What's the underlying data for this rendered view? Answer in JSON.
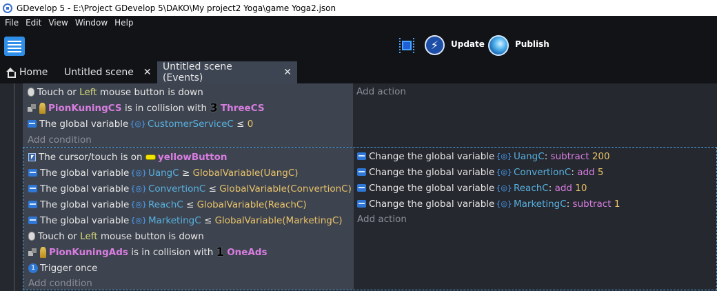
{
  "window": {
    "title": "GDevelop 5 - E:\\Project GDevelop 5\\DAKO\\My project2 Yoga\\game Yoga2.json"
  },
  "menu": [
    "File",
    "Edit",
    "View",
    "Window",
    "Help"
  ],
  "toolbar": {
    "update_label": "Update",
    "publish_label": "Publish"
  },
  "tabs": [
    {
      "label": "Home"
    },
    {
      "label": "Untitled scene"
    },
    {
      "label": "Untitled scene (Events)"
    }
  ],
  "tab_close": "✕",
  "events": [
    {
      "conditions": {
        "touch": {
          "pre": "Touch or",
          "button": "Left",
          "post": "mouse button is down"
        },
        "collision": {
          "object": "PionKuningCS",
          "text": "is in collision with",
          "number": "3",
          "target": "ThreeCS"
        },
        "variable": {
          "text": "The global variable",
          "name": "CustomerServiceC",
          "op": "≤",
          "value": "0"
        },
        "add": "Add condition"
      },
      "actions": {
        "add": "Add action"
      }
    },
    {
      "conditions": {
        "cursor": {
          "text": "The cursor/touch is on",
          "object": "yellowButton"
        },
        "vars": [
          {
            "text": "The global variable",
            "name": "UangC",
            "op": "≥",
            "value": "GlobalVariable(UangC)"
          },
          {
            "text": "The global variable",
            "name": "ConvertionC",
            "op": "≤",
            "value": "GlobalVariable(ConvertionC)"
          },
          {
            "text": "The global variable",
            "name": "ReachC",
            "op": "≤",
            "value": "GlobalVariable(ReachC)"
          },
          {
            "text": "The global variable",
            "name": "MarketingC",
            "op": "≤",
            "value": "GlobalVariable(MarketingC)"
          }
        ],
        "touch": {
          "pre": "Touch or",
          "button": "Left",
          "post": "mouse button is down"
        },
        "collision": {
          "object": "PionKuningAds",
          "text": "is in collision with",
          "number": "1",
          "target": "OneAds"
        },
        "trigger": "Trigger once",
        "trigger_icon_digit": "1",
        "add": "Add condition"
      },
      "actions": {
        "items": [
          {
            "text": "Change the global variable",
            "name": "UangC",
            "op": "subtract",
            "value": "200"
          },
          {
            "text": "Change the global variable",
            "name": "ConvertionC",
            "op": "add",
            "value": "5"
          },
          {
            "text": "Change the global variable",
            "name": "ReachC",
            "op": "add",
            "value": "10"
          },
          {
            "text": "Change the global variable",
            "name": "MarketingC",
            "op": "subtract",
            "value": "1"
          }
        ],
        "add": "Add action"
      }
    }
  ],
  "colors": {
    "accent": "#2f77d6",
    "object": "#d77de0",
    "variable": "#57b0e0",
    "value": "#e9c26a",
    "keyword": "#d5d97a"
  }
}
